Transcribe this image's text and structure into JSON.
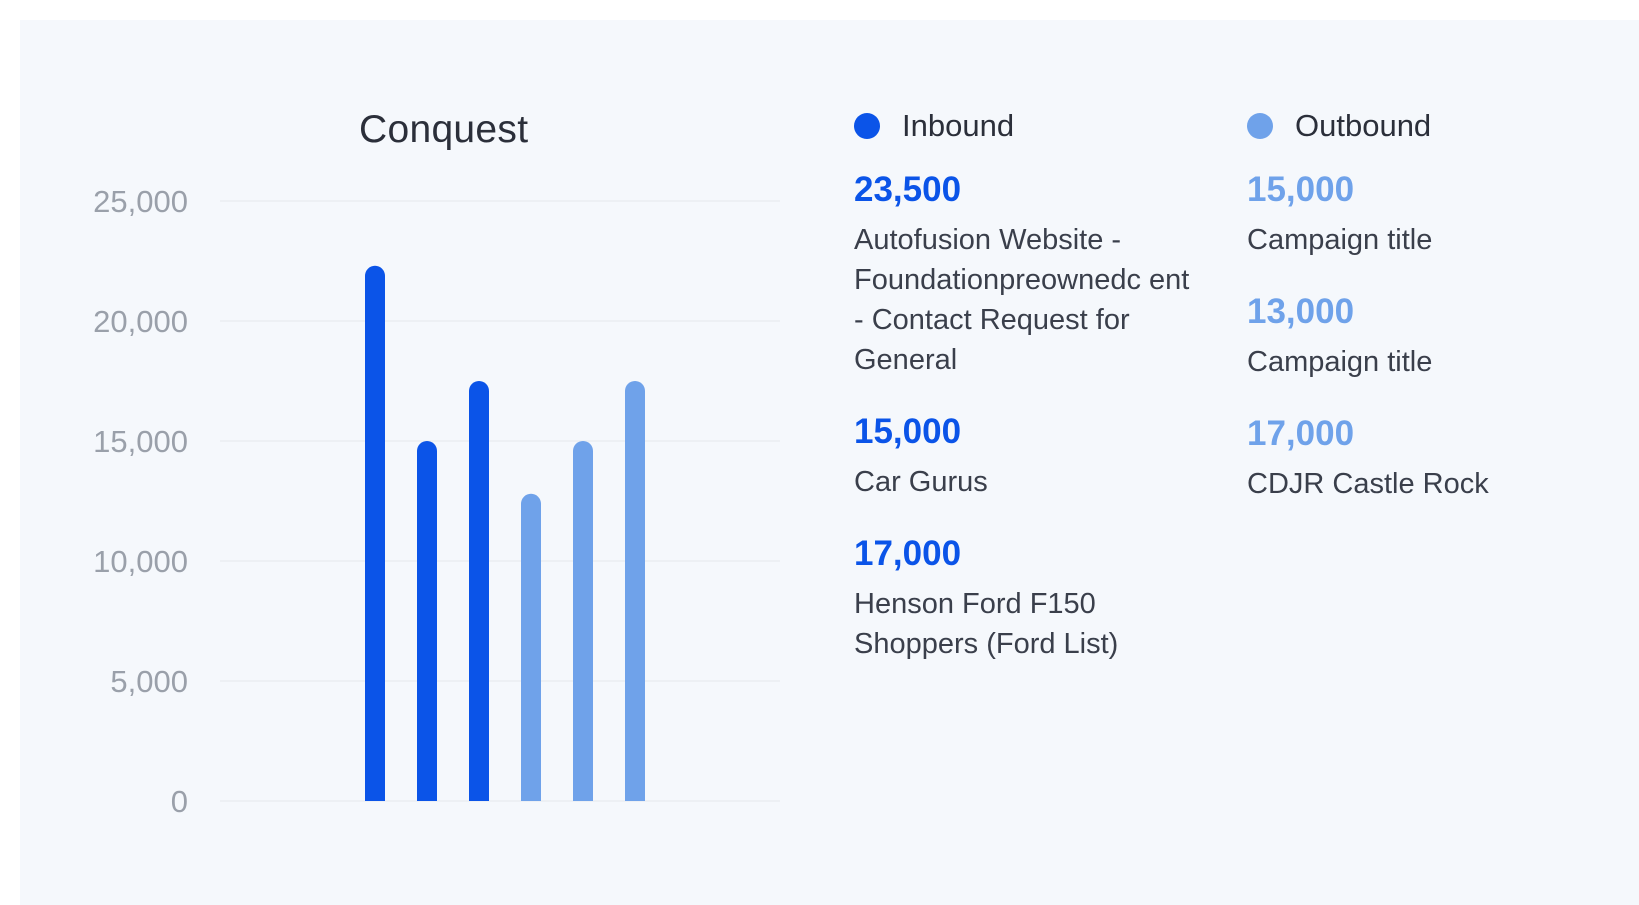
{
  "colors": {
    "inbound": "#0b54e8",
    "outbound": "#6fa2ea",
    "grid": "#edf0f4"
  },
  "legend": {
    "inbound_label": "Inbound",
    "outbound_label": "Outbound"
  },
  "inbound_list": [
    {
      "value": "23,500",
      "title": "Autofusion Website - Foundationpreownedc ent - Contact Request for General"
    },
    {
      "value": "15,000",
      "title": "Car Gurus"
    },
    {
      "value": "17,000",
      "title": "Henson Ford F150 Shoppers (Ford List)"
    }
  ],
  "outbound_list": [
    {
      "value": "15,000",
      "title": "Campaign title"
    },
    {
      "value": "13,000",
      "title": "Campaign title"
    },
    {
      "value": "17,000",
      "title": "CDJR Castle Rock"
    }
  ],
  "chart_data": {
    "type": "bar",
    "title": "Conquest",
    "xlabel": "",
    "ylabel": "",
    "ylim": [
      0,
      25000
    ],
    "yticks": [
      "0",
      "5,000",
      "10,000",
      "15,000",
      "20,000",
      "25,000"
    ],
    "grid": true,
    "legend_position": "right",
    "series": [
      {
        "name": "Inbound",
        "values": [
          22300,
          15000,
          17500
        ]
      },
      {
        "name": "Outbound",
        "values": [
          12800,
          15000,
          17500
        ]
      }
    ]
  }
}
